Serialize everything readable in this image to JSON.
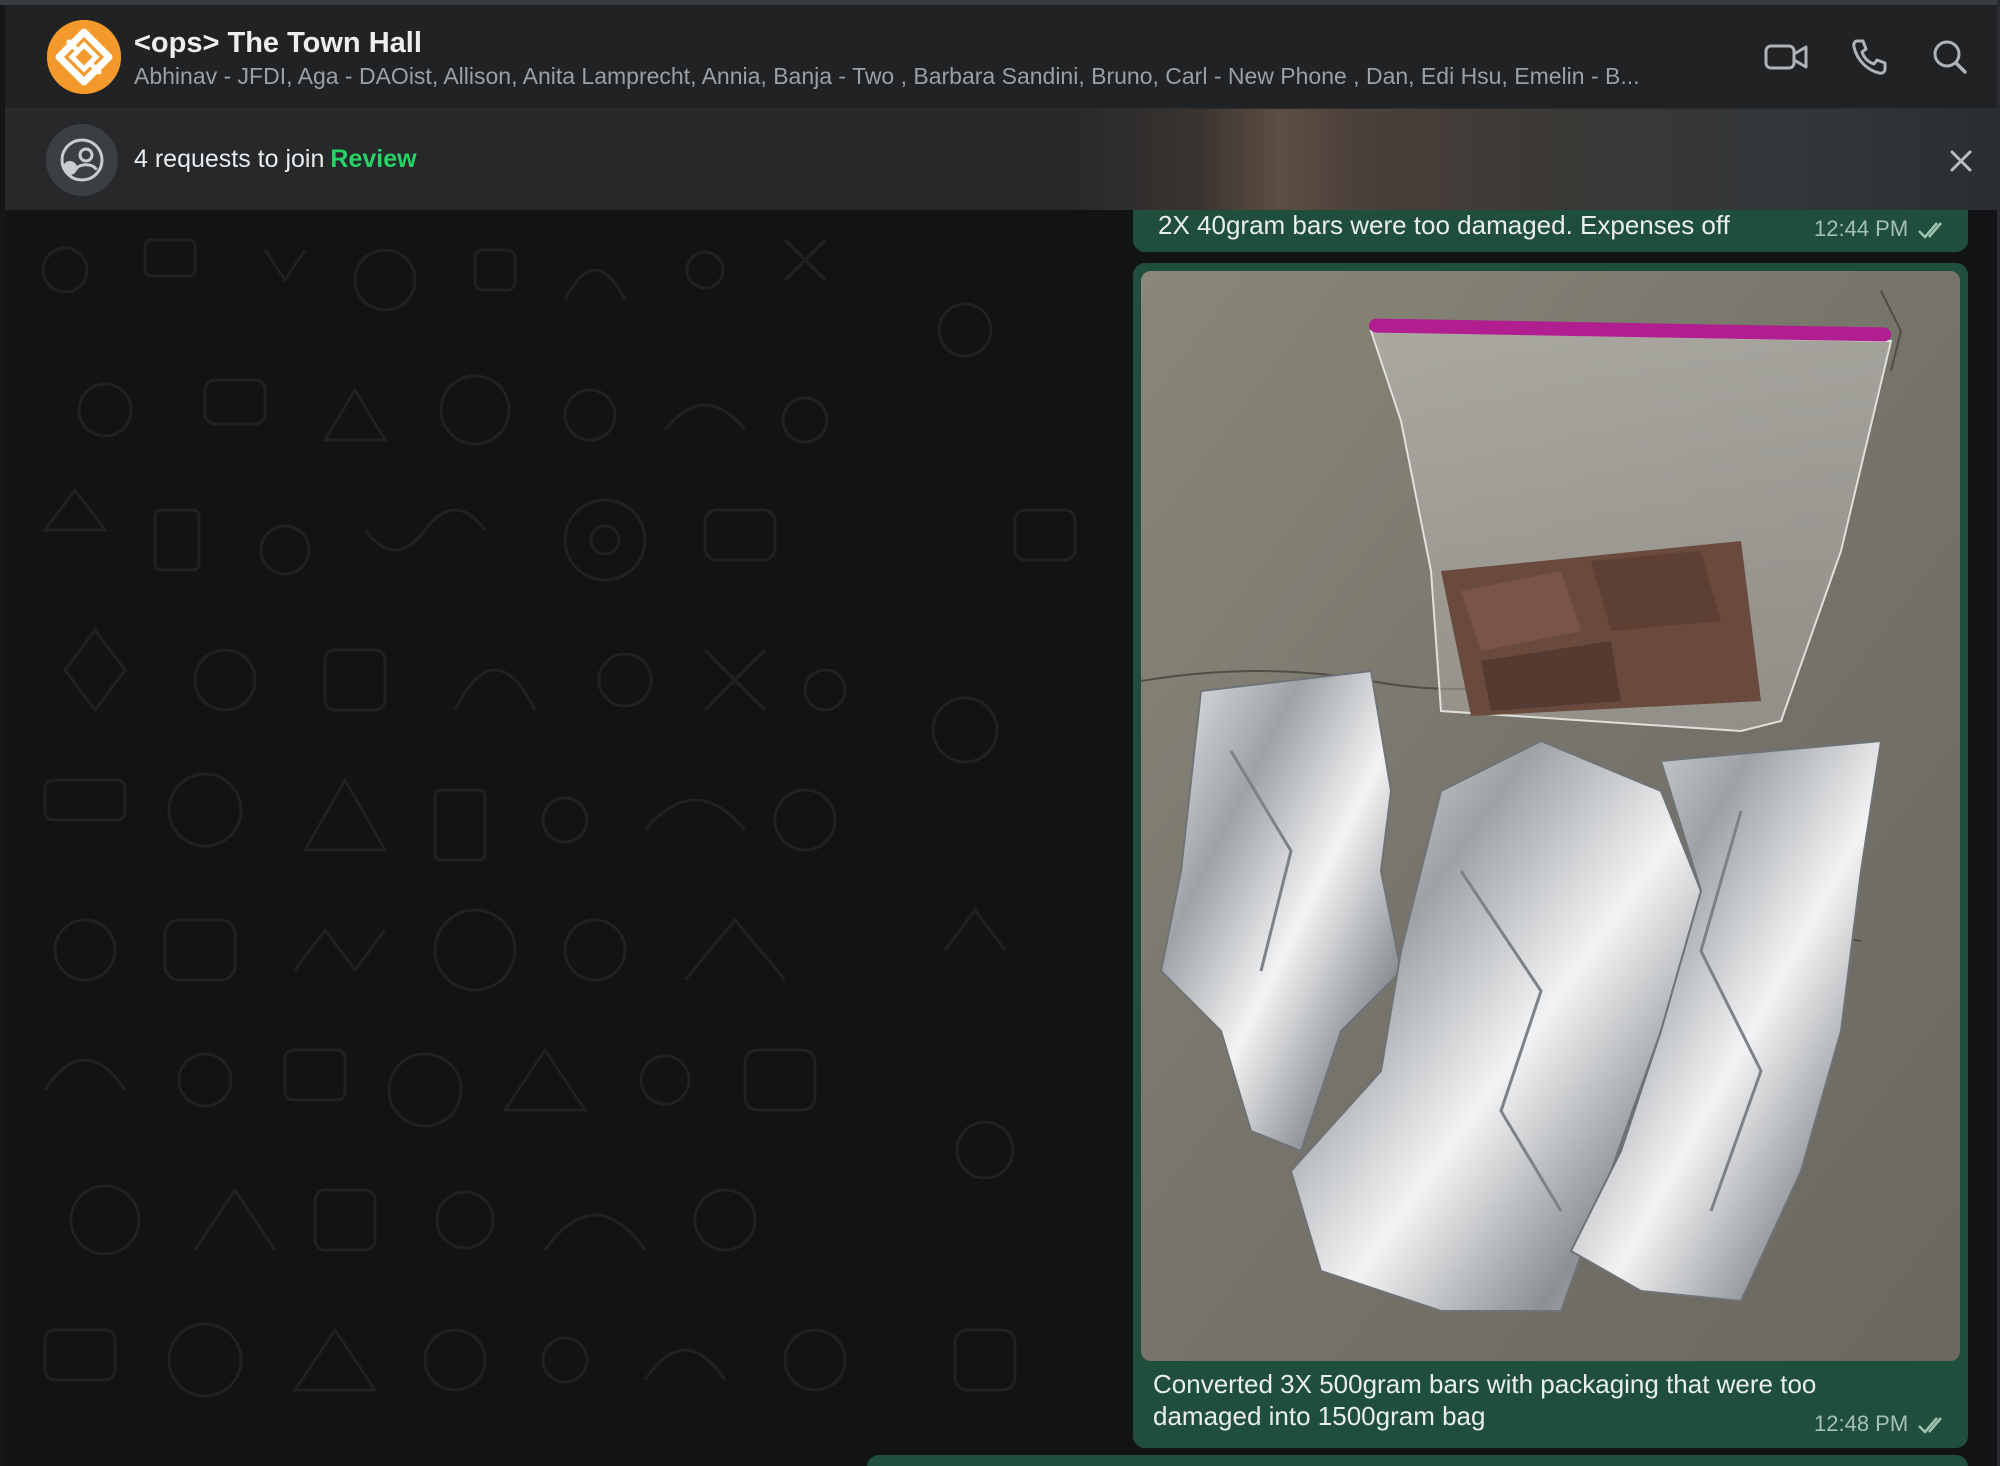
{
  "chat": {
    "title": "<ops> The Town Hall",
    "participants": "Abhinav - JFDI, Aga - DAOist, Allison, Anita Lamprecht, Annia, Banja - Two , Barbara Sandini, Bruno, Carl - New Phone , Dan, Edi Hsu, Emelin - B...",
    "avatar_icon": "group-logo-icon",
    "actions": [
      "video-call-icon",
      "voice-call-icon",
      "search-icon"
    ]
  },
  "banner": {
    "text": "4 requests to join",
    "link": "Review"
  },
  "messages": [
    {
      "text": "2X 40gram bars were too damaged. Expenses off",
      "time": "12:44 PM",
      "status": "read"
    },
    {
      "image": "photo of a zip bag of chocolate pieces and three crumpled foil wrappers on concrete",
      "caption_line1": "Converted 3X 500gram bars with packaging that were too",
      "caption_line2": "damaged into 1500gram bag",
      "time": "12:48 PM",
      "status": "read"
    }
  ],
  "colors": {
    "header_bg": "#202224",
    "outgoing_bubble": "#1f4f3c",
    "accent_green": "#25d366",
    "avatar_orange": "#f49a2d"
  }
}
